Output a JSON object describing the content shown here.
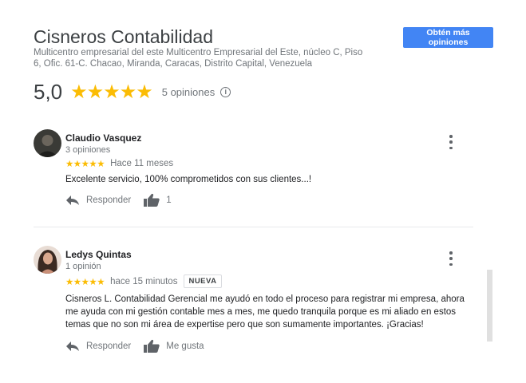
{
  "business": {
    "name": "Cisneros Contabilidad",
    "address": "Multicentro empresarial del este Multicentro Empresarial del Este, núcleo C, Piso 6, Ofic. 61-C. Chacao, Miranda, Caracas, Distrito Capital, Venezuela"
  },
  "cta": {
    "label": "Obtén más opiniones"
  },
  "summary": {
    "score": "5,0",
    "stars": "★★★★★",
    "count": "5 opiniones",
    "info_glyph": "i"
  },
  "reviews": [
    {
      "name": "Claudio Vasquez",
      "sub": "3 opiniones",
      "stars": "★★★★★",
      "time": "Hace 11 meses",
      "badge": "",
      "text": "Excelente servicio, 100% comprometidos con sus clientes...!",
      "reply_label": "Responder",
      "like_label": "1"
    },
    {
      "name": "Ledys Quintas",
      "sub": "1 opinión",
      "stars": "★★★★★",
      "time": "hace 15 minutos",
      "badge": "NUEVA",
      "text": "Cisneros L. Contabilidad Gerencial me ayudó en todo el proceso para registrar mi empresa, ahora me ayuda con mi gestión contable mes a mes, me quedo tranquila porque es mi aliado en estos temas que no son mi área de expertise pero que son sumamente importantes. ¡Gracias!",
      "reply_label": "Responder",
      "like_label": "Me gusta"
    }
  ],
  "colors": {
    "accent": "#4285f4",
    "star": "#fbbc04",
    "muted": "#70757a"
  }
}
